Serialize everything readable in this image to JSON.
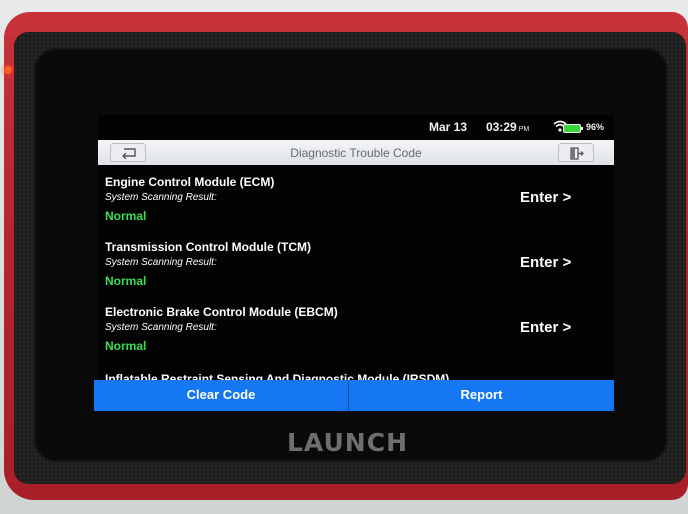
{
  "status_bar": {
    "date": "Mar 13",
    "time": "03:29",
    "time_suffix": "PM",
    "battery": "96%"
  },
  "header": {
    "title": "Diagnostic Trouble Code"
  },
  "modules": [
    {
      "name": "Engine Control Module (ECM)",
      "scan_label": "System Scanning Result:",
      "result": "Normal",
      "action": "Enter >"
    },
    {
      "name": "Transmission Control Module (TCM)",
      "scan_label": "System Scanning Result:",
      "result": "Normal",
      "action": "Enter >"
    },
    {
      "name": "Electronic Brake Control Module (EBCM)",
      "scan_label": "System Scanning Result:",
      "result": "Normal",
      "action": "Enter >"
    },
    {
      "name": "Inflatable Restraint Sensing And Diagnostic Module (IRSDM)"
    }
  ],
  "actions": {
    "clear_code": "Clear Code",
    "report": "Report"
  },
  "device": {
    "brand": "LAUNCH"
  },
  "colors": {
    "accent": "#1677f2",
    "status_ok": "#3bde52",
    "device_body": "#b8262e"
  },
  "icons": {
    "back": "back-arrow-icon",
    "exit": "exit-icon",
    "wifi": "wifi-icon",
    "battery": "battery-icon"
  }
}
